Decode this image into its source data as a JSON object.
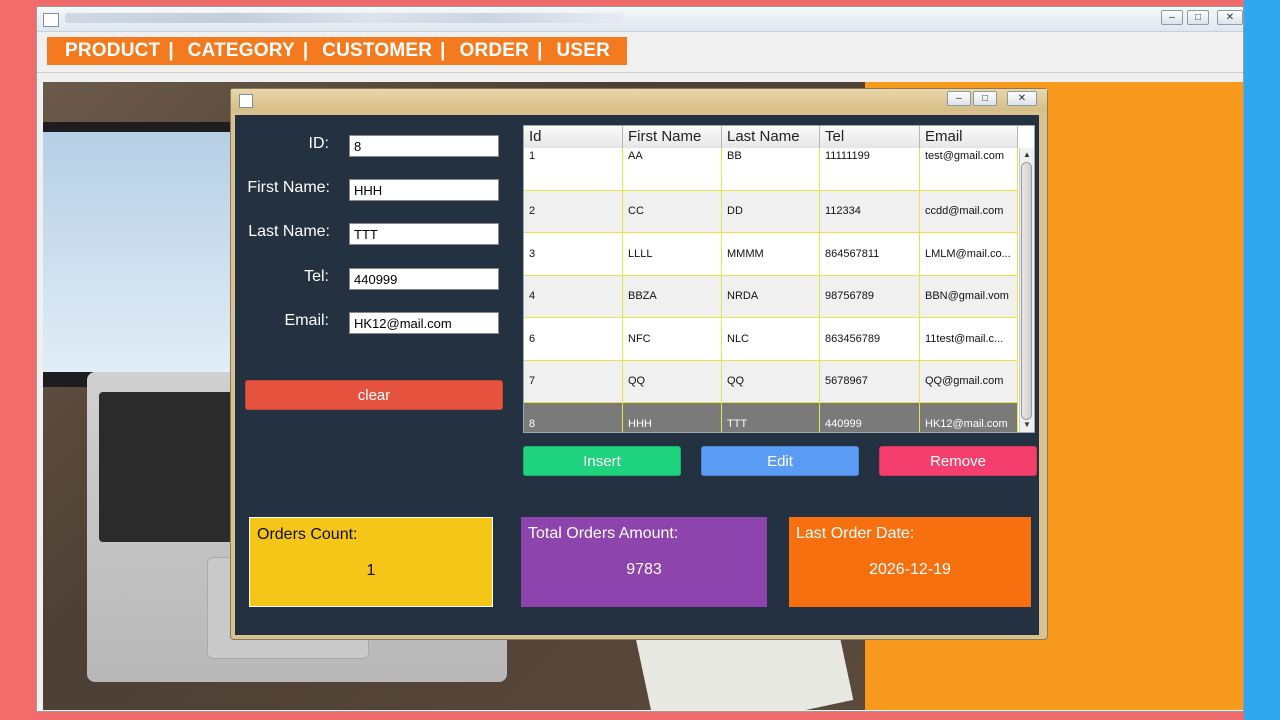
{
  "menu": {
    "items": [
      "PRODUCT",
      "CATEGORY",
      "CUSTOMER",
      "ORDER",
      "USER"
    ],
    "separator": "|"
  },
  "form": {
    "id_label": "ID:",
    "id_value": "8",
    "first_name_label": "First Name:",
    "first_name_value": "HHH",
    "last_name_label": "Last Name:",
    "last_name_value": "TTT",
    "tel_label": "Tel:",
    "tel_value": "440999",
    "email_label": "Email:",
    "email_value": "HK12@mail.com",
    "clear_label": "clear"
  },
  "table": {
    "columns": [
      "Id",
      "First Name",
      "Last Name",
      "Tel",
      "Email"
    ],
    "rows": [
      [
        "1",
        "AA",
        "BB",
        "11111199",
        "test@gmail.com"
      ],
      [
        "2",
        "CC",
        "DD",
        "112334",
        "ccdd@mail.com"
      ],
      [
        "3",
        "LLLL",
        "MMMM",
        "864567811",
        "LMLM@mail.co..."
      ],
      [
        "4",
        "BBZA",
        "NRDA",
        "98756789",
        "BBN@gmail.vom"
      ],
      [
        "6",
        "NFC",
        "NLC",
        "863456789",
        "11test@mail.c..."
      ],
      [
        "7",
        "QQ",
        "QQ",
        "5678967",
        "QQ@gmail.com"
      ],
      [
        "8",
        "HHH",
        "TTT",
        "440999",
        "HK12@mail.com"
      ]
    ],
    "selected_row": 6
  },
  "actions": {
    "insert_label": "Insert",
    "edit_label": "Edit",
    "remove_label": "Remove"
  },
  "stats": {
    "orders_count_label": "Orders Count:",
    "orders_count_value": "1",
    "total_amount_label": "Total Orders Amount:",
    "total_amount_value": "9783",
    "last_date_label": "Last Order Date:",
    "last_date_value": "2026-12-19"
  },
  "colors": {
    "menu_orange": "#f47a1f",
    "panel_bg": "#243140",
    "clear_red": "#e5533f",
    "insert_green": "#1fd37e",
    "edit_blue": "#5a9cf4",
    "remove_pink": "#f43f6e",
    "stat_yellow": "#f5c518",
    "stat_purple": "#8e44ad",
    "stat_orange": "#f7700f"
  },
  "icons": {
    "minimize": "minimize-icon",
    "maximize": "maximize-icon",
    "close": "close-icon",
    "scroll_up": "▲",
    "scroll_down": "▼"
  }
}
